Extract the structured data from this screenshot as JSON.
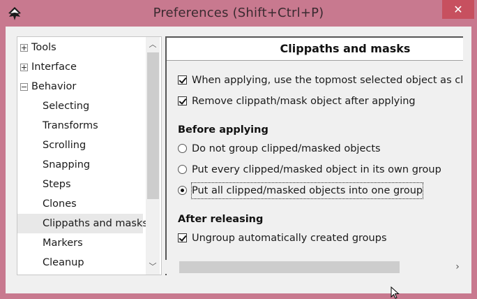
{
  "window": {
    "title": "Preferences (Shift+Ctrl+P)",
    "close_symbol": "✕",
    "app_icon": "inkscape-icon"
  },
  "tree": {
    "items": [
      {
        "label": "Tools",
        "expander": "plus",
        "indent": 0,
        "selected": false
      },
      {
        "label": "Interface",
        "expander": "plus",
        "indent": 0,
        "selected": false
      },
      {
        "label": "Behavior",
        "expander": "minus",
        "indent": 0,
        "selected": false
      },
      {
        "label": "Selecting",
        "expander": "",
        "indent": 1,
        "selected": false
      },
      {
        "label": "Transforms",
        "expander": "",
        "indent": 1,
        "selected": false
      },
      {
        "label": "Scrolling",
        "expander": "",
        "indent": 1,
        "selected": false
      },
      {
        "label": "Snapping",
        "expander": "",
        "indent": 1,
        "selected": false
      },
      {
        "label": "Steps",
        "expander": "",
        "indent": 1,
        "selected": false
      },
      {
        "label": "Clones",
        "expander": "",
        "indent": 1,
        "selected": false
      },
      {
        "label": "Clippaths and masks",
        "expander": "",
        "indent": 1,
        "selected": true
      },
      {
        "label": "Markers",
        "expander": "",
        "indent": 1,
        "selected": false
      },
      {
        "label": "Cleanup",
        "expander": "",
        "indent": 1,
        "selected": false
      }
    ],
    "scroll_up": "︿",
    "scroll_down": "﹀"
  },
  "page": {
    "title": "Clippaths and masks",
    "options": {
      "use_topmost": {
        "label": "When applying, use the topmost selected object as clippat",
        "checked": true
      },
      "remove_after": {
        "label": "Remove clippath/mask object after applying",
        "checked": true
      }
    },
    "before_heading": "Before applying",
    "before_options": [
      {
        "label": "Do not group clipped/masked objects",
        "checked": false
      },
      {
        "label": "Put every clipped/masked object in its own group",
        "checked": false
      },
      {
        "label": "Put all clipped/masked objects into one group",
        "checked": true
      }
    ],
    "after_heading": "After releasing",
    "ungroup": {
      "label": "Ungroup automatically created groups",
      "checked": true
    }
  },
  "hscroll": {
    "left": "‹",
    "right": "›"
  },
  "colors": {
    "titlebar": "#c8798f",
    "close_button": "#c7505f",
    "dialog_bg": "#f0f0f0"
  }
}
